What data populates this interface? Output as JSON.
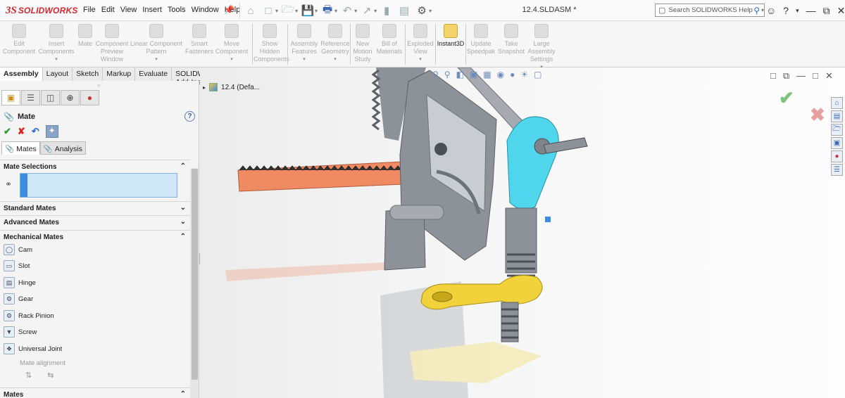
{
  "app": {
    "logo_ds": "3S",
    "logo_name": "SOLIDWORKS",
    "menu": [
      "File",
      "Edit",
      "View",
      "Insert",
      "Tools",
      "Window",
      "Help"
    ],
    "document_title": "12.4.SLDASM *",
    "search_placeholder": "Search SOLIDWORKS Help"
  },
  "ribbon": {
    "buttons": [
      {
        "label": "Edit Component",
        "icon": "edit-component-icon",
        "active": false
      },
      {
        "label": "Insert Components",
        "icon": "insert-components-icon",
        "active": false
      },
      {
        "label": "Mate",
        "icon": "mate-icon",
        "active": false
      },
      {
        "label": "Component Preview Window",
        "icon": "preview-window-icon",
        "active": false
      },
      {
        "label": "Linear Component Pattern",
        "icon": "linear-pattern-icon",
        "active": false
      },
      {
        "label": "Smart Fasteners",
        "icon": "smart-fasteners-icon",
        "active": false
      },
      {
        "label": "Move Component",
        "icon": "move-component-icon",
        "active": false
      },
      {
        "label": "Show Hidden Components",
        "icon": "show-hidden-icon",
        "active": false
      },
      {
        "label": "Assembly Features",
        "icon": "assembly-features-icon",
        "active": false
      },
      {
        "label": "Reference Geometry",
        "icon": "reference-geometry-icon",
        "active": false
      },
      {
        "label": "New Motion Study",
        "icon": "motion-study-icon",
        "active": false
      },
      {
        "label": "Bill of Materials",
        "icon": "bom-icon",
        "active": false
      },
      {
        "label": "Exploded View",
        "icon": "exploded-view-icon",
        "active": false
      },
      {
        "label": "Instant3D",
        "icon": "instant3d-icon",
        "active": true
      },
      {
        "label": "Update Speedpak",
        "icon": "speedpak-icon",
        "active": false
      },
      {
        "label": "Take Snapshot",
        "icon": "snapshot-icon",
        "active": false
      },
      {
        "label": "Large Assembly Settings",
        "icon": "large-assembly-icon",
        "active": false
      }
    ]
  },
  "tabs": [
    {
      "label": "Assembly",
      "active": true
    },
    {
      "label": "Layout",
      "active": false
    },
    {
      "label": "Sketch",
      "active": false
    },
    {
      "label": "Markup",
      "active": false
    },
    {
      "label": "Evaluate",
      "active": false
    },
    {
      "label": "SOLIDWORKS Add-Ins",
      "active": false
    }
  ],
  "panel": {
    "title": "Mate",
    "subtabs": [
      "Mates",
      "Analysis"
    ],
    "sections": {
      "mate_selections": "Mate Selections",
      "standard_mates": "Standard Mates",
      "advanced_mates": "Advanced Mates",
      "mechanical_mates": "Mechanical Mates",
      "mates": "Mates"
    },
    "mechanical_mates": [
      "Cam",
      "Slot",
      "Hinge",
      "Gear",
      "Rack Pinion",
      "Screw",
      "Universal Joint"
    ],
    "mate_alignment_label": "Mate alignment"
  },
  "viewport": {
    "tree_root_label": "12.4  (Defa..."
  },
  "colors": {
    "rack": "#f08a62",
    "cam_follower": "#4fd6ec",
    "arm": "#f2d23a",
    "body": "#8d9299",
    "accent": "#d3282f"
  }
}
